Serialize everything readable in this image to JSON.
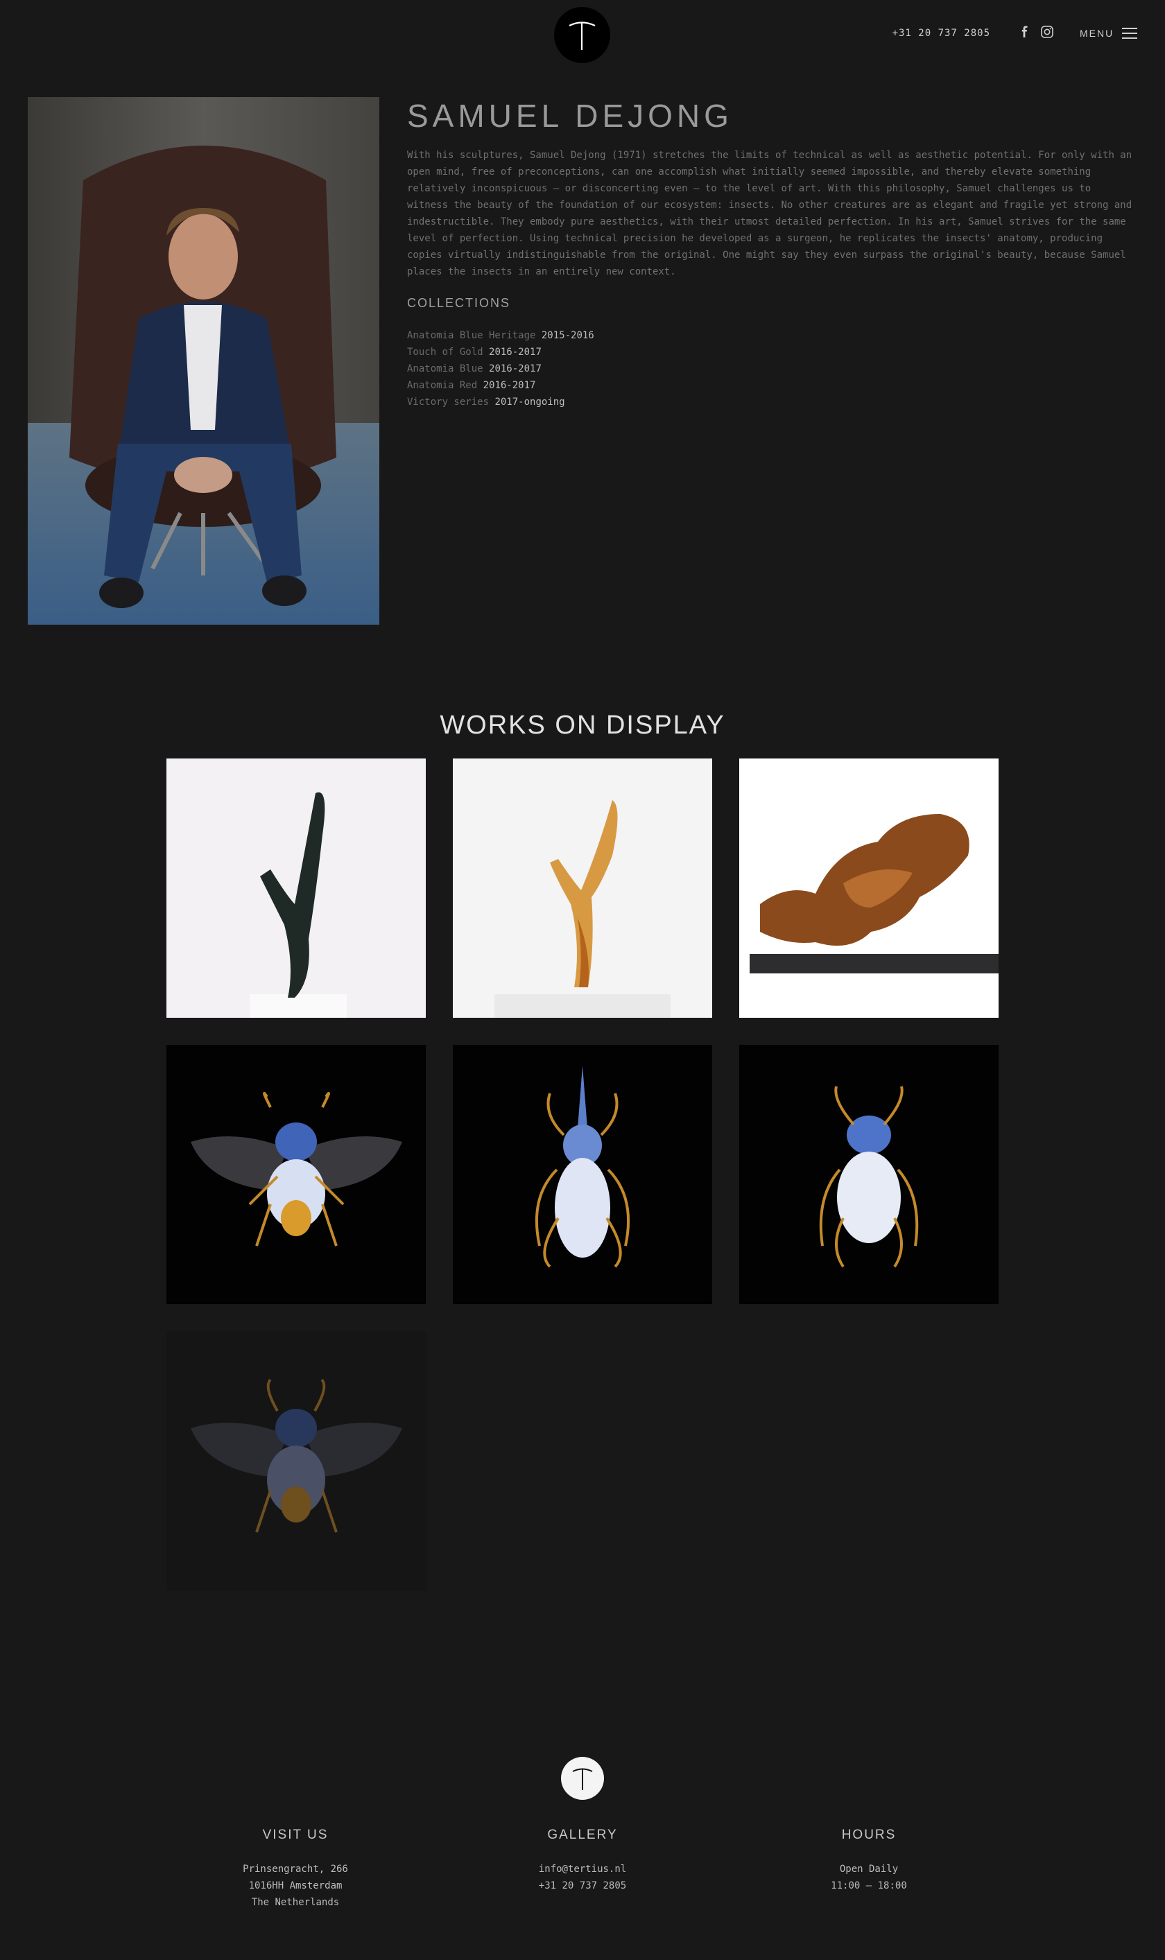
{
  "header": {
    "phone": "+31 20 737 2805",
    "menu_label": "MENU"
  },
  "artist": {
    "name": "SAMUEL DEJONG",
    "bio": "With his sculptures, Samuel Dejong (1971) stretches the limits of technical as well as aesthetic potential. For only with an open mind, free of preconceptions, can one accomplish what initially seemed impossible, and thereby elevate something relatively inconspicuous – or disconcerting even – to the level of art. With this philosophy, Samuel challenges us to witness the beauty of the foundation of our ecosystem: insects. No other creatures are as elegant and fragile yet strong and indestructible. They embody pure aesthetics, with their utmost detailed perfection. In his art, Samuel strives for the same level of perfection. Using technical precision he developed as a surgeon, he replicates the insects' anatomy, producing copies virtually indistinguishable from the original. One might say they even surpass the original's beauty, because Samuel places the insects in an entirely new context.",
    "collections_title": "COLLECTIONS",
    "collections": [
      {
        "name": "Anatomia Blue Heritage",
        "years": "2015-2016"
      },
      {
        "name": "Touch of Gold",
        "years": "2016-2017"
      },
      {
        "name": "Anatomia Blue",
        "years": "2016-2017"
      },
      {
        "name": "Anatomia Red",
        "years": "2016-2017"
      },
      {
        "name": "Victory series",
        "years": "2017-ongoing"
      }
    ]
  },
  "works": {
    "title": "WORKS ON DISPLAY",
    "items": [
      {
        "subject": "dark-victory-sculpture"
      },
      {
        "subject": "gold-victory-sculpture"
      },
      {
        "subject": "wood-sculpture"
      },
      {
        "subject": "winged-blue-beetle"
      },
      {
        "subject": "horned-blue-beetle"
      },
      {
        "subject": "round-blue-beetle"
      },
      {
        "subject": "winged-blue-beetle-faded"
      }
    ]
  },
  "footer": {
    "visit": {
      "title": "VISIT US",
      "line1": "Prinsengracht, 266",
      "line2": "1016HH Amsterdam",
      "line3": "The Netherlands"
    },
    "gallery": {
      "title": "GALLERY",
      "email": "info@tertius.nl",
      "phone": "+31 20 737 2805"
    },
    "hours": {
      "title": "HOURS",
      "line1": "Open Daily",
      "line2": "11:00 – 18:00"
    }
  }
}
